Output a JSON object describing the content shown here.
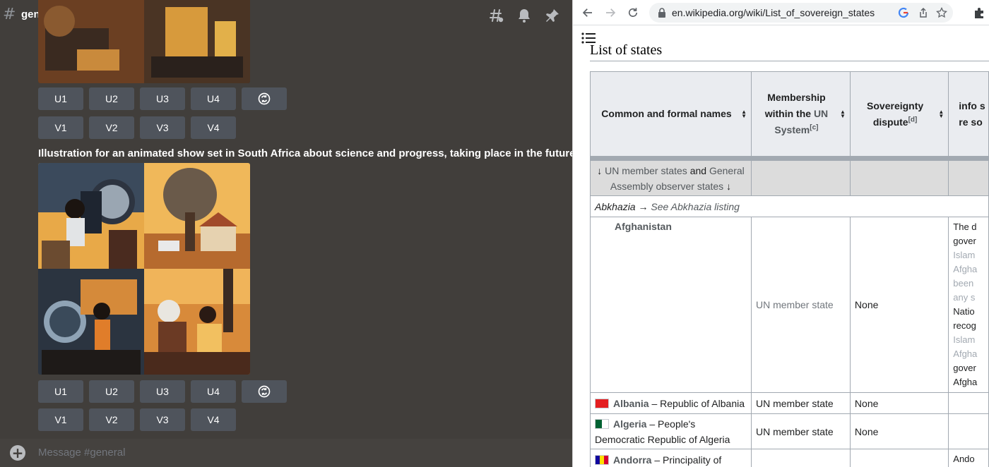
{
  "discord": {
    "channel_name": "general",
    "prompt": "Illustration for an animated show set in South Africa about science and progress, taking place in the future",
    "buttons_upscale": [
      "U1",
      "U2",
      "U3",
      "U4"
    ],
    "buttons_variation": [
      "V1",
      "V2",
      "V3",
      "V4"
    ],
    "message_placeholder": "Message #general",
    "header_icons": [
      "threads-icon",
      "bell-icon",
      "pin-icon"
    ]
  },
  "browser": {
    "url": "en.wikipedia.org/wiki/List_of_sovereign_states",
    "section_title": "List of states",
    "table": {
      "headers": {
        "col1": "Common and formal names",
        "col2_a": "Membership within the ",
        "col2_un": "UN",
        "col2_b": " System",
        "col2_note": "[c]",
        "col3_a": "Sovereignty dispute",
        "col3_note": "[d]",
        "col4": "info s re so"
      },
      "group_row": {
        "arrow_left": "↓ ",
        "link_a": "UN member states",
        "and": " and ",
        "link_b": "General Assembly observer states",
        "arrow_right": " ↓"
      },
      "abkhazia": {
        "name": "Abkhazia",
        "arrow": " → ",
        "see": "See Abkhazia listing"
      },
      "rows": [
        {
          "name": "Afghanistan",
          "formal": "",
          "membership": "UN member state",
          "dispute": "None",
          "info": [
            "The d",
            "gover",
            "Islam",
            "Afgha",
            "been",
            "any s",
            "Natio",
            "recog",
            "Islam",
            "Afgha",
            "gover",
            "Afgha"
          ]
        },
        {
          "name": "Albania",
          "formal": " – Republic of Albania",
          "membership": "UN member state",
          "dispute": "None"
        },
        {
          "name": "Algeria",
          "formal": " – People's Democratic Republic of Algeria",
          "membership": "UN member state",
          "dispute": "None"
        },
        {
          "name": "Andorra",
          "formal": " – Principality of",
          "membership": "",
          "dispute": "",
          "info_first": "Ando"
        }
      ]
    }
  },
  "colors": {
    "discord_bg": "#413e3b",
    "discord_button": "#4f545c",
    "wiki_link": "#3366cc",
    "wiki_border": "#a2a9b1",
    "wiki_header_bg": "#eaecf0"
  }
}
